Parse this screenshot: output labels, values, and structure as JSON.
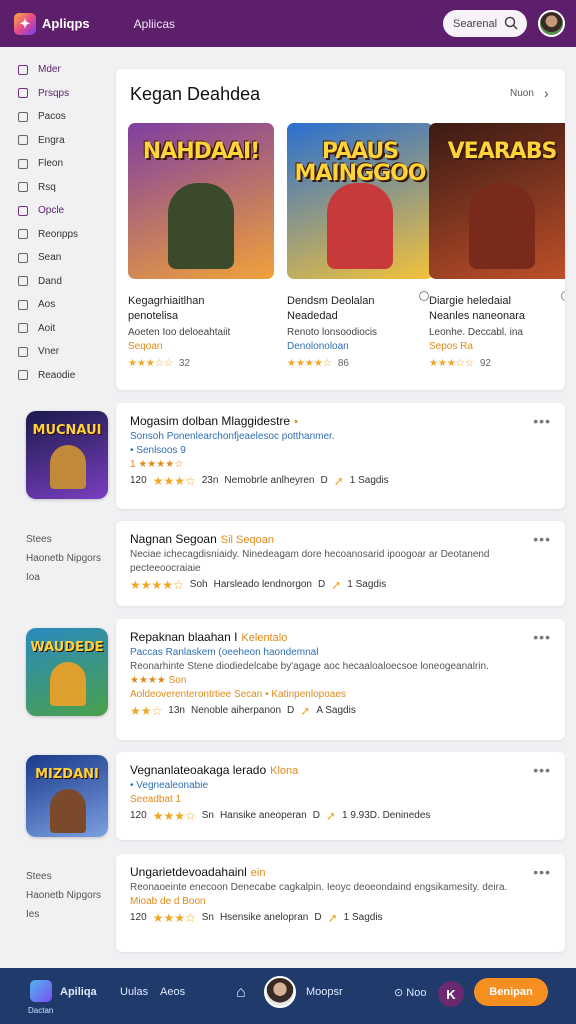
{
  "header": {
    "brand": "Apliqps",
    "app_name": "Apliicas",
    "search_placeholder": "Searenal"
  },
  "sidebar": {
    "items": [
      {
        "label": "Mder",
        "accent": true
      },
      {
        "label": "Prsqps",
        "accent": true
      },
      {
        "label": "Pacos",
        "accent": false
      },
      {
        "label": "Engra",
        "accent": false
      },
      {
        "label": "Fleon",
        "accent": false
      },
      {
        "label": "Rsq",
        "accent": false
      },
      {
        "label": "Opcle",
        "accent": true
      },
      {
        "label": "Reonpps",
        "accent": false
      },
      {
        "label": "Sean",
        "accent": false
      },
      {
        "label": "Dand",
        "accent": false
      },
      {
        "label": "Aos",
        "accent": false
      },
      {
        "label": "Aoit",
        "accent": false
      },
      {
        "label": "Vner",
        "accent": false
      },
      {
        "label": "Reaodie",
        "accent": false
      }
    ]
  },
  "featured": {
    "title": "Kegan Deahdea",
    "more_label": "Nuon",
    "games": [
      {
        "art_title": "NAHDAAI!",
        "title": "Kegagrhiaitlhan",
        "subtitle": "penotelisa",
        "desc": "Aoeten Ioo deloeahtaiit",
        "category": "Seqoan",
        "category_color": "orange",
        "rating": "★★★☆☆",
        "rating_value": "32",
        "bg": [
          "#7f3fa0",
          "#f0a23a"
        ],
        "hero": "#3b4a2a"
      },
      {
        "art_title": "PAAUS MAINGGOO",
        "title": "Dendsm Deolalan",
        "subtitle": "Neadedad",
        "desc": "Renoto lonsoodiocis",
        "category": "Denolonoloan",
        "category_color": "blue",
        "rating": "★★★★☆",
        "rating_value": "86",
        "bg": [
          "#2a6fd0",
          "#f4c23a"
        ],
        "hero": "#c83a3a"
      },
      {
        "art_title": "VEARABS",
        "title": "Diargie heledaial",
        "subtitle": "Neanles naneonara",
        "desc": "Leonhe. Deccabl. ina",
        "category": "Sepos Ra",
        "category_color": "orange",
        "rating": "★★★☆☆",
        "rating_value": "92",
        "bg": [
          "#3a1a14",
          "#c0502a"
        ],
        "hero": "#7a2a1a"
      }
    ]
  },
  "list_thumbs": [
    {
      "text": "MUCNAUI",
      "bg": [
        "#1a1a4a",
        "#7a3fc0"
      ],
      "hero": "#c08a3a"
    },
    {
      "text": "WAUDEDE",
      "bg": [
        "#2a8ac0",
        "#4aa04a"
      ],
      "hero": "#e0a030"
    },
    {
      "text": "MIZDANI",
      "bg": [
        "#1a3a8a",
        "#7aa0e0"
      ],
      "hero": "#7a4a2a"
    }
  ],
  "side_notes": [
    {
      "lines": [
        "Stees",
        "Haonetb Nipgors",
        "Ioa"
      ]
    },
    {
      "lines": [
        "Stees",
        "Haonetb Nipgors",
        "Ies"
      ]
    }
  ],
  "rows": [
    {
      "title": "Mogasim dolban Mlaggidestre",
      "tag": "•",
      "lines": [
        {
          "text": "Sonsoh Ponenlearchonfjeaelesoc potthanmer.",
          "color": "blue"
        },
        {
          "text": "• Senlsoos 9",
          "color": "blue"
        },
        {
          "text": "1 ★★★★☆",
          "color": "orange"
        }
      ],
      "meta_left": "120",
      "meta_stars": "★★★☆",
      "meta_mid": "23n",
      "meta_text": "Nemobrle anlheyren",
      "meta_b": "D",
      "meta_right": "1 Sagdis"
    },
    {
      "title": "Nagnan Segoan",
      "tag": "Sil Seqoan",
      "lines": [
        {
          "text": "Neciae ichecagdisniaidy. Ninedeagam dore hecoanosarid ipoogoar ar Deotanend",
          "color": "gray"
        },
        {
          "text": "pecteeoocraiaie",
          "color": "gray"
        }
      ],
      "meta_left": "",
      "meta_stars": "★★★★☆",
      "meta_mid": "Soh",
      "meta_text": "Harsleado lendnorgon",
      "meta_b": "D",
      "meta_right": "1 Sagdis"
    },
    {
      "title": "Repaknan blaahan I",
      "tag": "Kelentalo",
      "lines": [
        {
          "text": "Paccas Ranlaskem (oeeheon haondemnal",
          "color": "blue"
        },
        {
          "text": "Reonarhinte Stene diodiedelcabe by'agage aoc hecaaloaloecsoe loneogeanalrin.",
          "color": "gray"
        },
        {
          "text": "★★★★ Son",
          "color": "orange"
        },
        {
          "text": "Aoldeoverenterontrtiee Secan • Katinpenlopoaes",
          "color": "orange"
        }
      ],
      "meta_left": "",
      "meta_stars": "★★☆",
      "meta_mid": "13n",
      "meta_text": "Nenoble aiherpanon",
      "meta_b": "D",
      "meta_right": "A Sagdis"
    },
    {
      "title": "Vegnanlateoakaga lerado",
      "tag": "Klona",
      "lines": [
        {
          "text": "• Vegnealeonabie",
          "color": "blue"
        },
        {
          "text": "Seeadbat 1",
          "color": "orange"
        }
      ],
      "meta_left": "120",
      "meta_stars": "★★★☆",
      "meta_mid": "Sn",
      "meta_text": "Hansike aneoperan",
      "meta_b": "D",
      "meta_right": "1 9.93D. Deninedes"
    },
    {
      "title": "Ungarietdevoadahainl",
      "tag": "ein",
      "lines": [
        {
          "text": "Reonaoeinte enecoon Denecabe cagkalpin. Ieoyc deoeondaind engsikamesity. deira.",
          "color": "gray"
        },
        {
          "text": "Mioab de d Boon",
          "color": "orange"
        }
      ],
      "meta_left": "120",
      "meta_stars": "★★★☆",
      "meta_mid": "Sn",
      "meta_text": "Hsensike anelopran",
      "meta_b": "D",
      "meta_right": "1 Sagdis"
    }
  ],
  "bottom": {
    "brand": "Apiliqa",
    "brand_sub": "Dactan",
    "link1": "Uulas",
    "link2": "Aeos",
    "profile": "Moopsr",
    "settings": "Noo",
    "cta": "Benipan"
  },
  "colors": {
    "header": "#5d1f6b",
    "accent": "#f59020",
    "bottom": "#1f3a6b"
  }
}
